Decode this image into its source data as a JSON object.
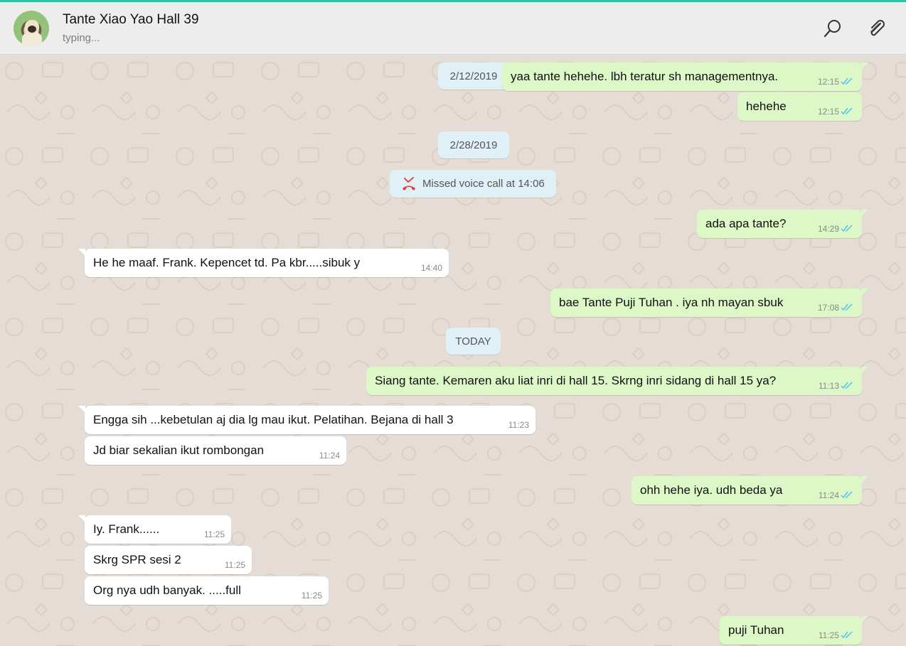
{
  "header": {
    "contact_name": "Tante Xiao Yao Hall 39",
    "status": "typing...",
    "accent_color": "#2ec4a5",
    "icons": [
      "search-icon",
      "paperclip-icon"
    ]
  },
  "date_chips": {
    "d1": "2/12/2019",
    "d2": "2/28/2019",
    "d3": "TODAY"
  },
  "call": {
    "text": "Missed voice call at 14:06",
    "icon": "missed-call-icon"
  },
  "messages": [
    {
      "dir": "out",
      "text": "yaa tante hehehe. lbh teratur sh managementnya.",
      "time": "12:15",
      "status": "read"
    },
    {
      "dir": "out",
      "text": "hehehe",
      "time": "12:15",
      "status": "read"
    },
    {
      "dir": "out",
      "text": "ada apa tante?",
      "time": "14:29",
      "status": "read"
    },
    {
      "dir": "in",
      "text": "He he maaf. Frank.  Kepencet td.    Pa kbr.....sibuk y",
      "time": "14:40"
    },
    {
      "dir": "out",
      "text": "bae Tante Puji Tuhan . iya nh mayan sbuk",
      "time": "17:08",
      "status": "read"
    },
    {
      "dir": "out",
      "text": "Siang tante. Kemaren aku liat inri di hall 15. Skrng inri sidang di hall 15 ya?",
      "time": "11:13",
      "status": "read"
    },
    {
      "dir": "in",
      "text": "Engga sih ...kebetulan aj dia lg mau ikut. Pelatihan. Bejana di hall 3",
      "time": "11:23"
    },
    {
      "dir": "in",
      "text": "Jd biar sekalian ikut rombongan",
      "time": "11:24"
    },
    {
      "dir": "out",
      "text": "ohh hehe iya. udh beda ya",
      "time": "11:24",
      "status": "read"
    },
    {
      "dir": "in",
      "text": "Iy. Frank......",
      "time": "11:25"
    },
    {
      "dir": "in",
      "text": "Skrg SPR sesi 2",
      "time": "11:25"
    },
    {
      "dir": "in",
      "text": "Org nya udh banyak.    .....full",
      "time": "11:25"
    },
    {
      "dir": "out",
      "text": "puji Tuhan",
      "time": "11:25",
      "status": "read"
    }
  ],
  "colors": {
    "outgoing_bubble": "#dcf8c6",
    "incoming_bubble": "#ffffff",
    "chat_background": "#e5ddd5",
    "read_ticks": "#4fc3f7",
    "missed_call": "#e53935"
  }
}
